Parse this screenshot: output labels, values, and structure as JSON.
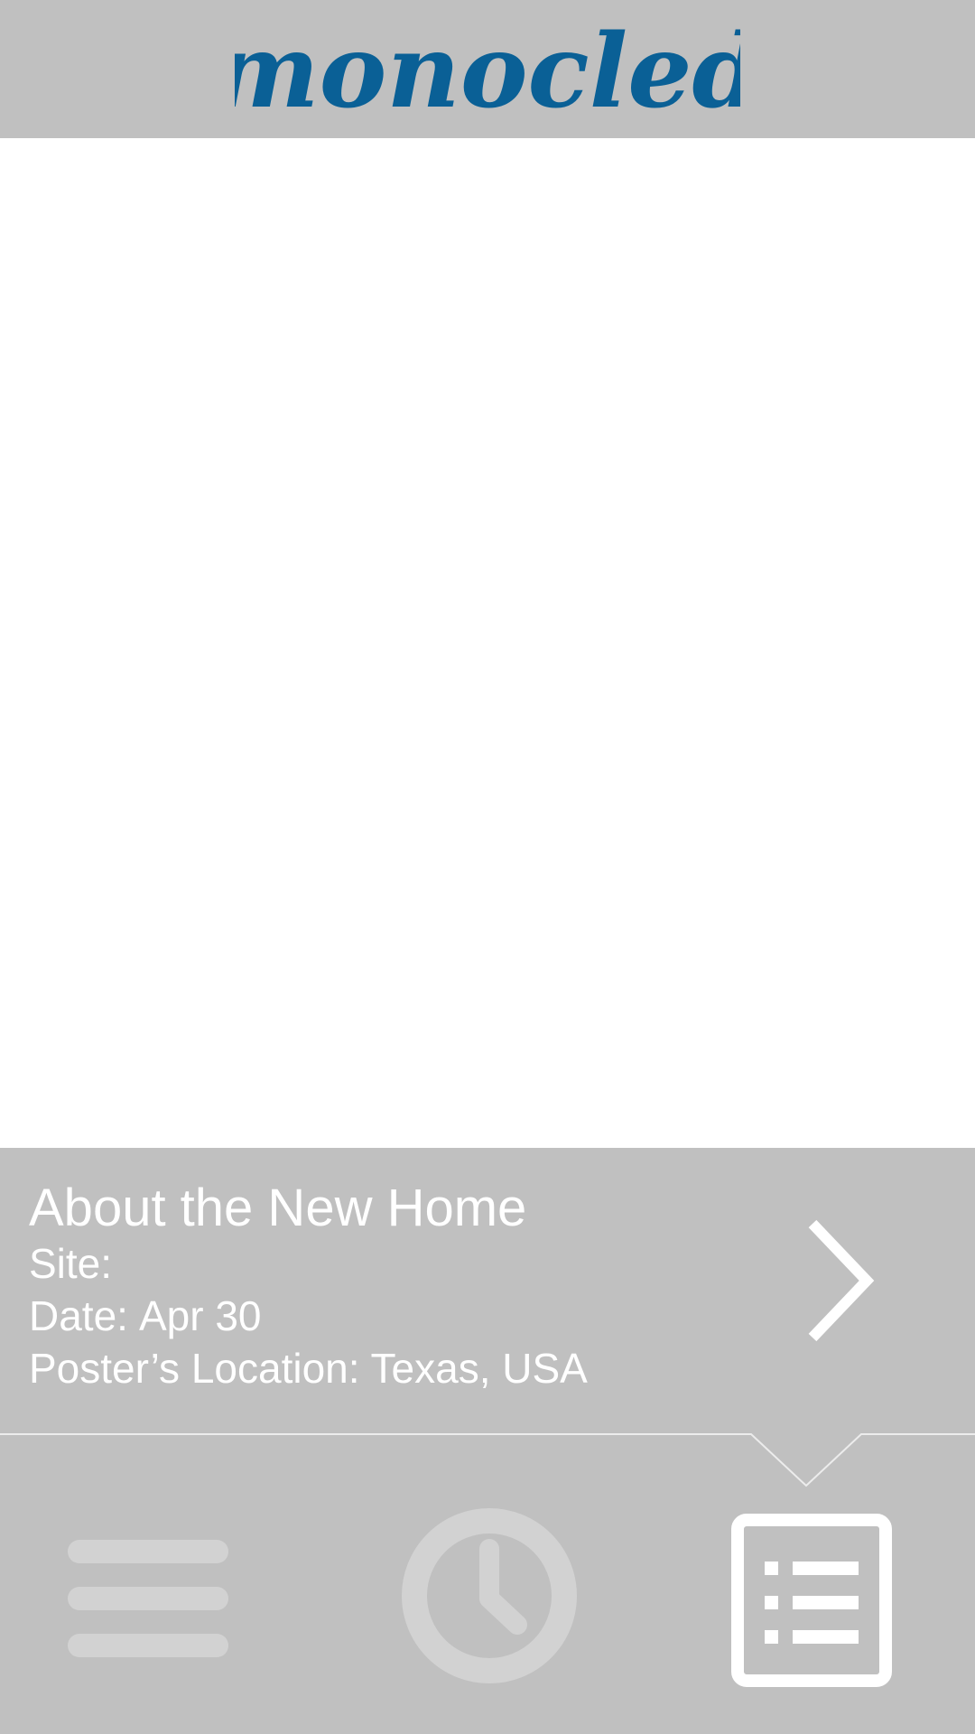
{
  "header": {
    "brand": "monocled",
    "brand_color": "#0a6096"
  },
  "info": {
    "title": "About the New Home",
    "site_label": "Site:",
    "site_value": "",
    "date_label": "Date:",
    "date_value": "Apr 30",
    "location_label": "Poster’s Location:",
    "location_value": "Texas, USA",
    "next_icon": "chevron-right-icon"
  },
  "tabs": [
    {
      "id": "menu",
      "icon": "hamburger-icon",
      "active": false
    },
    {
      "id": "recent",
      "icon": "clock-icon",
      "active": false
    },
    {
      "id": "details",
      "icon": "list-icon",
      "active": true
    }
  ],
  "colors": {
    "bar_background": "#c0c0c0",
    "active_icon": "#ffffff",
    "inactive_icon": "#d2d2d2",
    "content_background": "#ffffff"
  }
}
